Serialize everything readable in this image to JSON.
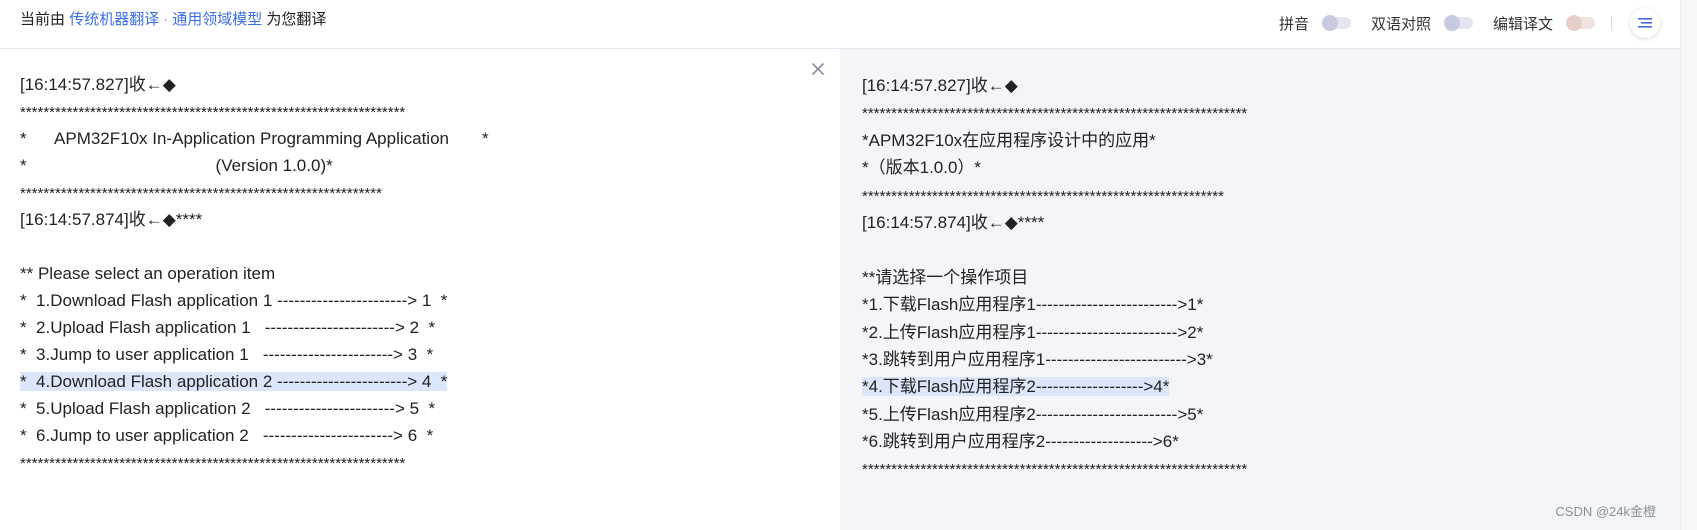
{
  "topbar": {
    "prefix": "当前由",
    "engine_link": "传统机器翻译",
    "separator": "·",
    "model_link": "通用领域模型",
    "suffix": "为您翻译",
    "toggles": [
      {
        "label": "拼音",
        "on": false
      },
      {
        "label": "双语对照",
        "on": false
      },
      {
        "label": "编辑译文",
        "on": false
      }
    ],
    "menu_icon": "list-menu-icon"
  },
  "source": {
    "lines": [
      "[16:14:57.827]收←◆",
      "******************************************************************",
      "*      APM32F10x In-Application Programming Application       *",
      "*                                        (Version 1.0.0)*",
      "**************************************************************",
      "[16:14:57.874]收←◆****",
      "",
      "** Please select an operation item",
      "*  1.Download Flash application 1 -----------------------> 1  *",
      "*  2.Upload Flash application 1   -----------------------> 2  *",
      "*  3.Jump to user application 1   -----------------------> 3  *",
      "*  4.Download Flash application 2 -----------------------> 4  *",
      "*  5.Upload Flash application 2   -----------------------> 5  *",
      "*  6.Jump to user application 2   -----------------------> 6  *",
      "******************************************************************"
    ],
    "highlighted_index": 11
  },
  "translation": {
    "lines": [
      "[16:14:57.827]收←◆",
      "******************************************************************",
      "*APM32F10x在应用程序设计中的应用*",
      "*（版本1.0.0）*",
      "**************************************************************",
      "[16:14:57.874]收←◆****",
      "",
      "**请选择一个操作项目",
      "*1.下载Flash应用程序1------------------------->1*",
      "*2.上传Flash应用程序1------------------------->2*",
      "*3.跳转到用户应用程序1------------------------->3*",
      "*4.下载Flash应用程序2------------------->4*",
      "*5.上传Flash应用程序2------------------------->5*",
      "*6.跳转到用户应用程序2------------------->6*",
      "******************************************************************"
    ],
    "highlighted_index": 11
  },
  "close_icon": "close-icon",
  "watermark": "CSDN @24k金橙",
  "colors": {
    "link": "#3d6ee8",
    "highlight": "#dbe6fb",
    "right_pane_bg": "#f4f5f8"
  }
}
